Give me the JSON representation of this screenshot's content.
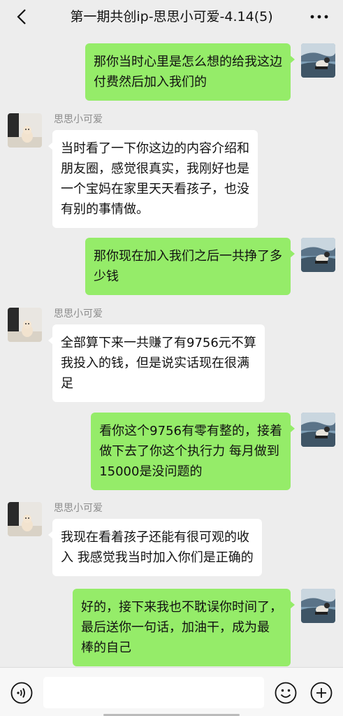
{
  "header": {
    "title": "第一期共创ip-思思小可爱-4.14(5)"
  },
  "messages": [
    {
      "from": "me",
      "lines": [
        "那你当时心里是怎么想的给我这边",
        "付费然后加入我们的"
      ]
    },
    {
      "from": "her",
      "sender": "思思小可爱",
      "lines": [
        "当时看了一下你这边的内容介绍和",
        "朋友圈，感觉很真实，我刚好也是",
        "一个宝妈在家里天天看孩子，也没",
        "有别的事情做。"
      ]
    },
    {
      "from": "me",
      "lines": [
        "那你现在加入我们之后一共挣了多",
        "少钱"
      ]
    },
    {
      "from": "her",
      "sender": "思思小可爱",
      "lines": [
        "全部算下来一共赚了有9756元不算",
        "我投入的钱，但是说实话现在很满",
        "足"
      ]
    },
    {
      "from": "me",
      "lines": [
        "看你这个9756有零有整的，接着",
        "做下去了你这个执行力 每月做到",
        "15000是没问题的"
      ]
    },
    {
      "from": "her",
      "sender": "思思小可爱",
      "lines": [
        "我现在看着孩子还能有很可观的收",
        "入 我感觉我当时加入你们是正确的"
      ]
    },
    {
      "from": "me",
      "lines": [
        "好的，接下来我也不耽误你时间了，",
        "最后送你一句话，加油干，成为最",
        "棒的自己"
      ]
    }
  ],
  "input": {
    "value": "",
    "placeholder": ""
  },
  "colors": {
    "my_bubble": "#95ec69",
    "her_bubble": "#ffffff",
    "background": "#ededed"
  },
  "icons": {
    "back": "chevron-left-icon",
    "more": "more-dots-icon",
    "voice": "voice-icon",
    "emoji": "emoji-icon",
    "plus": "plus-icon"
  }
}
